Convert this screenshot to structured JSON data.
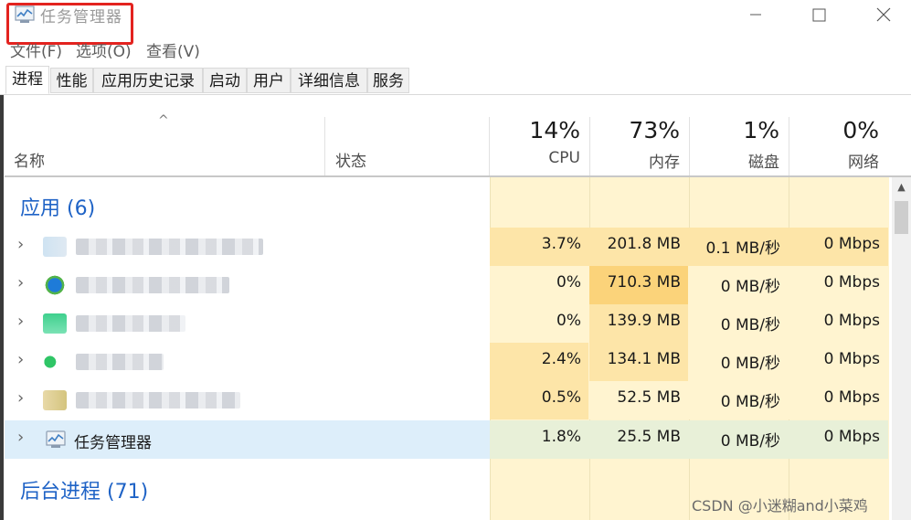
{
  "window": {
    "title": "任务管理器",
    "minimize_icon": "minimize-icon",
    "maximize_icon": "maximize-icon",
    "close_icon": "close-icon"
  },
  "menu": [
    "文件(F)",
    "选项(O)",
    "查看(V)"
  ],
  "tabs": [
    "进程",
    "性能",
    "应用历史记录",
    "启动",
    "用户",
    "详细信息",
    "服务"
  ],
  "header": {
    "sort_indicator": "^",
    "name_label": "名称",
    "status_label": "状态",
    "cpu_percent": "14%",
    "cpu_label": "CPU",
    "mem_percent": "73%",
    "mem_label": "内存",
    "disk_percent": "1%",
    "disk_label": "磁盘",
    "net_percent": "0%",
    "net_label": "网络"
  },
  "groups": {
    "apps": "应用 (6)",
    "background": "后台进程 (71)"
  },
  "rows": [
    {
      "name": "",
      "cpu": "3.7%",
      "memory": "201.8 MB",
      "disk": "0.1 MB/秒",
      "network": "0 Mbps"
    },
    {
      "name": "",
      "cpu": "0%",
      "memory": "710.3 MB",
      "disk": "0 MB/秒",
      "network": "0 Mbps"
    },
    {
      "name": "",
      "cpu": "0%",
      "memory": "139.9 MB",
      "disk": "0 MB/秒",
      "network": "0 Mbps"
    },
    {
      "name": "",
      "cpu": "2.4%",
      "memory": "134.1 MB",
      "disk": "0 MB/秒",
      "network": "0 Mbps"
    },
    {
      "name": "",
      "cpu": "0.5%",
      "memory": "52.5 MB",
      "disk": "0 MB/秒",
      "network": "0 Mbps"
    },
    {
      "name": "任务管理器",
      "cpu": "1.8%",
      "memory": "25.5 MB",
      "disk": "0 MB/秒",
      "network": "0 Mbps"
    }
  ],
  "colors": {
    "metric_bg": "#fff4d0",
    "metric_bg_strong": "#fde5a8",
    "metric_bg_hot": "#fbd37a",
    "group_title": "#1f63c6",
    "highlight_row": "#ddeefa",
    "callout_border": "#e3231f"
  },
  "watermark": "CSDN @小迷糊and小菜鸡"
}
